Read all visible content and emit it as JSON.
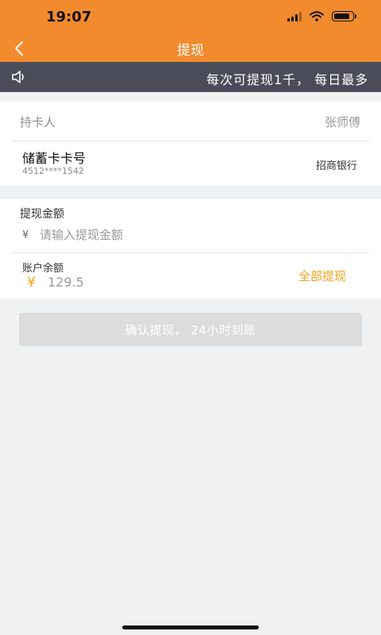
{
  "status_bar": {
    "time": "19:07"
  },
  "nav": {
    "title": "提现"
  },
  "notice": {
    "text": "每次可提现1千，  每日最多"
  },
  "card_info": {
    "holder_label": "持卡人",
    "holder_name": "张师傅",
    "card_type": "储蓄卡卡号",
    "card_number": "4512****1542",
    "bank_name": "招商银行"
  },
  "withdraw": {
    "amount_label": "提现金额",
    "currency_symbol": "¥",
    "amount_placeholder": "请输入提现金额",
    "balance_label": "账户余额",
    "balance_currency": "¥",
    "balance_value": "129.5",
    "withdraw_all_label": "全部提现"
  },
  "confirm_button": {
    "label": "确认提现，  24小时到账"
  },
  "colors": {
    "brand": "#f28a2e",
    "notice_bg": "#4a4d59",
    "accent": "#f0a11d",
    "disabled_button": "#dcdcdc"
  }
}
